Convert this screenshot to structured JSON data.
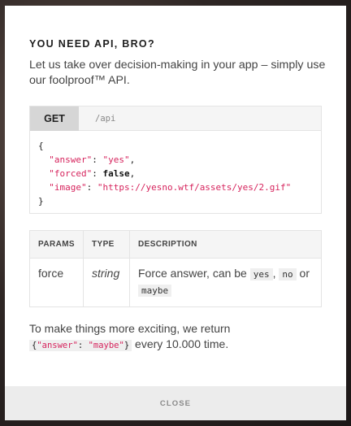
{
  "modal": {
    "title": "YOU NEED API, BRO?",
    "intro": "Let us take over decision-making in your app – simply use our foolproof™ API."
  },
  "request": {
    "method": "GET",
    "endpoint": "/api"
  },
  "response": {
    "open_brace": "{",
    "close_brace": "}",
    "fields": [
      {
        "key": "\"answer\"",
        "colon": ": ",
        "value": "\"yes\"",
        "trail": ","
      },
      {
        "key": "\"forced\"",
        "colon": ": ",
        "value": "false",
        "trail": ","
      },
      {
        "key": "\"image\"",
        "colon": ": ",
        "value": "\"https://yesno.wtf/assets/yes/2.gif\"",
        "trail": ""
      }
    ]
  },
  "params_table": {
    "headers": [
      "PARAMS",
      "TYPE",
      "DESCRIPTION"
    ],
    "rows": [
      {
        "param": "force",
        "type": "string",
        "desc_prefix": "Force answer, can be ",
        "opt1": "yes",
        "sep1": ", ",
        "opt2": "no",
        "sep2": " or",
        "opt3": "maybe"
      }
    ]
  },
  "footer": {
    "text_before": "To make things more exciting, we return",
    "code_open": "{",
    "code_key": "\"answer\"",
    "code_colon": ": ",
    "code_val": "\"maybe\"",
    "code_close": "}",
    "text_after": " every 10.000 time."
  },
  "close_label": "CLOSE"
}
